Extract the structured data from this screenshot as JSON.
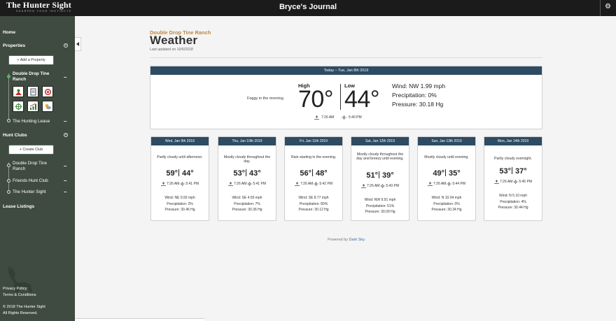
{
  "brand": {
    "name": "The Hunter Sight",
    "tagline": "SHARPEN YOUR INSTINCTS"
  },
  "app_title": "Bryce's Journal",
  "sidebar": {
    "home": "Home",
    "properties": "Properties",
    "add_property": "+ Add a Property",
    "property_active": "Double Drop Tine Ranch",
    "property_other": "The Hunting Lease",
    "hunt_clubs": "Hunt Clubs",
    "create_club": "+ Create Club",
    "clubs": [
      "Double Drop Tine Ranch",
      "Friends Hunt Club",
      "The Hunter Sight"
    ],
    "lease_listings": "Lease Listings",
    "privacy": "Privacy Policy",
    "terms": "Terms & Conditions",
    "copyright": "© 2018 The Hunter Sight",
    "rights": "All Rights Reserved."
  },
  "main": {
    "ranch_name": "Double Drop Tine Ranch",
    "title": "Weather",
    "last_updated": "Last updated on 10/6/2018"
  },
  "today": {
    "header": "Today – Tue, Jan 8th 2019",
    "summary": "Foggy in the morning.",
    "high_label": "High",
    "low_label": "Low",
    "high": "70°",
    "low": "44°",
    "sunrise": "7:26 AM",
    "sunset": "5:40 PM",
    "wind": "Wind: NW 1.99 mph",
    "precipitation": "Precipitation: 0%",
    "pressure": "Pressure: 30.18 Hg"
  },
  "forecast": [
    {
      "date": "Wed, Jan 9th 2019",
      "summary": "Partly cloudy until afternoon.",
      "high": "59°",
      "low": "44°",
      "sunrise": "7:26 AM",
      "sunset": "5:41 PM",
      "wind": "Wind: NE 9.93 mph",
      "precip": "Precipitation: 2%",
      "pressure": "Pressure: 30.46 Hg"
    },
    {
      "date": "Thu, Jan 10th 2019",
      "summary": "Mostly cloudy throughout the day.",
      "high": "53°",
      "low": "43°",
      "sunrise": "7:26 AM",
      "sunset": "5:41 PM",
      "wind": "Wind: SE 4.50 mph",
      "precip": "Precipitation: 7%",
      "pressure": "Pressure: 30.36 Hg"
    },
    {
      "date": "Fri, Jan 11th 2019",
      "summary": "Rain starting in the evening.",
      "high": "56°",
      "low": "48°",
      "sunrise": "7:26 AM",
      "sunset": "5:42 PM",
      "wind": "Wind: SE 8.77 mph",
      "precip": "Precipitation: 80%",
      "pressure": "Pressure: 30.12 Hg"
    },
    {
      "date": "Sat, Jan 12th 2019",
      "summary": "Mostly cloudy throughout the day and breezy until evening.",
      "high": "51°",
      "low": "39°",
      "sunrise": "7:26 AM",
      "sunset": "5:43 PM",
      "wind": "Wind: NW 9.91 mph",
      "precip": "Precipitation: 51%",
      "pressure": "Pressure: 30.09 Hg"
    },
    {
      "date": "Sun, Jan 13th 2019",
      "summary": "Mostly cloudy until evening.",
      "high": "49°",
      "low": "35°",
      "sunrise": "7:26 AM",
      "sunset": "5:44 PM",
      "wind": "Wind: N 10.04 mph",
      "precip": "Precipitation: 0%",
      "pressure": "Pressure: 30.34 Hg"
    },
    {
      "date": "Mon, Jan 14th 2019",
      "summary": "Partly cloudy overnight.",
      "high": "53°",
      "low": "37°",
      "sunrise": "7:26 AM",
      "sunset": "5:45 PM",
      "wind": "Wind: N 5.10 mph",
      "precip": "Precipitation: 4%",
      "pressure": "Pressure: 30.44 Hg"
    }
  ],
  "footer": {
    "powered_by": "Powered by",
    "dark_sky": "Dark Sky",
    "period": "."
  },
  "icons": [
    "settings-icon",
    "collapse-arrow-icon",
    "sunrise-icon",
    "sunset-icon",
    "map-icon",
    "journal-icon",
    "target-icon",
    "crosshair-icon",
    "chart-icon",
    "weather-icon",
    "deer-silhouette-icon"
  ],
  "colors": {
    "sidebar": "#3f4a40",
    "header_bar": "#2d4b63",
    "accent_orange": "#c0853e",
    "active_green": "#4dbb56"
  }
}
